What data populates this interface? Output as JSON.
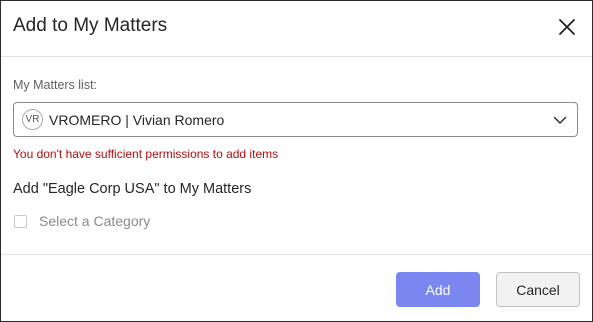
{
  "dialog": {
    "title": "Add to My Matters",
    "close_icon": "close-icon"
  },
  "list": {
    "label": "My Matters list:",
    "avatar_initials": "VR",
    "selected_value": "VROMERO | Vivian Romero",
    "dropdown_icon": "chevron-down-icon"
  },
  "error": {
    "message": "You don't have sufficient permissions to add items",
    "color": "#b00e0e"
  },
  "add_to": {
    "label": "Add \"Eagle Corp USA\" to My Matters"
  },
  "category": {
    "label": "Select a Category",
    "checked": false
  },
  "buttons": {
    "add_label": "Add",
    "cancel_label": "Cancel",
    "add_color": "#7b86f0"
  }
}
